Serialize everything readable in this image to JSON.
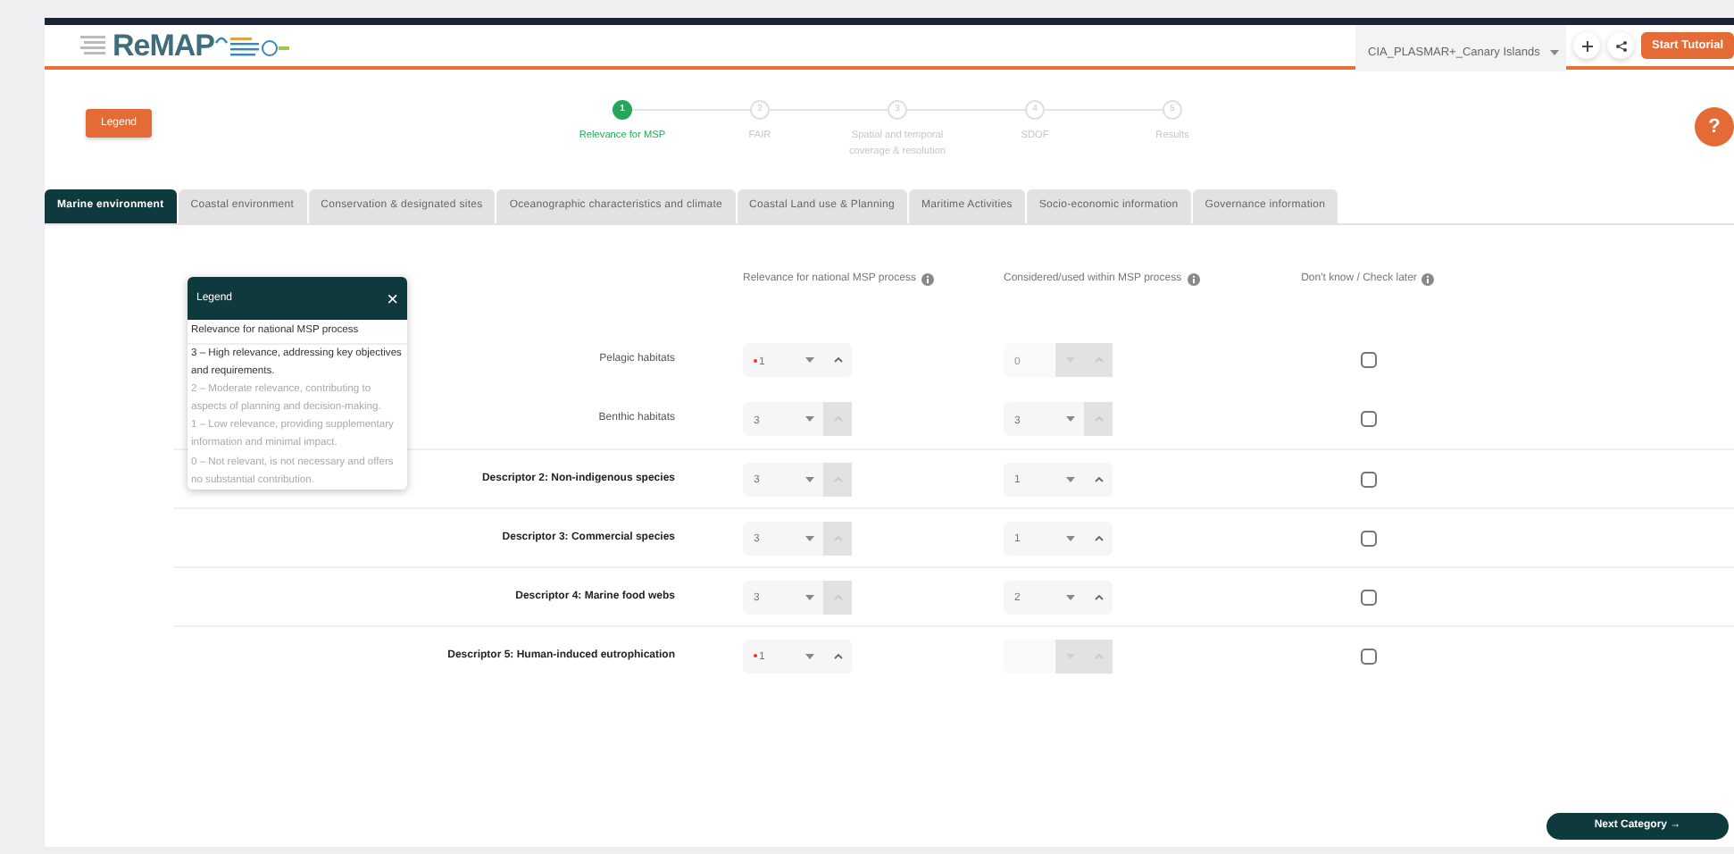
{
  "header": {
    "logo": "ReMAP",
    "country_select": {
      "value": "CIA_PLASMAR+_Canary Islands"
    },
    "start_tutorial": "Start Tutorial"
  },
  "legend_button": "Legend",
  "steps": [
    {
      "number": "1",
      "label": "Relevance for MSP",
      "selected": true
    },
    {
      "number": "2",
      "label": "FAIR",
      "selected": false
    },
    {
      "number": "3",
      "label": "Spatial and temporal coverage & resolution",
      "selected": false
    },
    {
      "number": "4",
      "label": "SDOF",
      "selected": false
    },
    {
      "number": "5",
      "label": "Results",
      "selected": false
    }
  ],
  "help_button": "?",
  "tabs": [
    {
      "label": "Marine environment",
      "selected": true
    },
    {
      "label": "Coastal environment",
      "selected": false
    },
    {
      "label": "Conservation & designated sites",
      "selected": false
    },
    {
      "label": "Oceanographic characteristics and climate",
      "selected": false
    },
    {
      "label": "Coastal Land use & Planning",
      "selected": false
    },
    {
      "label": "Maritime Activities",
      "selected": false
    },
    {
      "label": "Socio-economic information",
      "selected": false
    },
    {
      "label": "Governance information",
      "selected": false
    }
  ],
  "columns": [
    "Relevance for national MSP process",
    "Considered/used within MSP process",
    "Don't know / Check later"
  ],
  "rows": [
    {
      "label": "Pelagic habitats",
      "kind": "sub",
      "relevance": {
        "value": "1",
        "required": true,
        "disabled": false,
        "up_disabled": false
      },
      "considered": {
        "value": "0",
        "disabled": true,
        "up_disabled": true
      },
      "dont_know": false
    },
    {
      "label": "Benthic habitats",
      "kind": "sub",
      "relevance": {
        "value": "3",
        "required": false,
        "disabled": false,
        "up_disabled": true
      },
      "considered": {
        "value": "3",
        "disabled": false,
        "up_disabled": true
      },
      "dont_know": false
    },
    {
      "label": "Descriptor 2: Non-indigenous species",
      "kind": "descriptor",
      "relevance": {
        "value": "3",
        "required": false,
        "disabled": false,
        "up_disabled": true
      },
      "considered": {
        "value": "1",
        "disabled": false,
        "up_disabled": false
      },
      "dont_know": false
    },
    {
      "label": "Descriptor 3: Commercial species",
      "kind": "descriptor",
      "relevance": {
        "value": "3",
        "required": false,
        "disabled": false,
        "up_disabled": true
      },
      "considered": {
        "value": "1",
        "disabled": false,
        "up_disabled": false
      },
      "dont_know": false
    },
    {
      "label": "Descriptor 4: Marine food webs",
      "kind": "descriptor",
      "relevance": {
        "value": "3",
        "required": false,
        "disabled": false,
        "up_disabled": true
      },
      "considered": {
        "value": "2",
        "disabled": false,
        "up_disabled": false
      },
      "dont_know": false
    },
    {
      "label": "Descriptor 5: Human-induced eutrophication",
      "kind": "descriptor",
      "relevance": {
        "value": "1",
        "required": true,
        "disabled": false,
        "up_disabled": false
      },
      "considered": {
        "disabled": true,
        "up_disabled": true
      },
      "dont_know": false
    }
  ],
  "legend_popover": {
    "title": "Legend",
    "close": "×",
    "heading": "Relevance for national MSP process",
    "items": [
      {
        "text": "3 – High relevance, addressing key objectives and requirements.",
        "selected": true
      },
      {
        "text": "2 – Moderate relevance, contributing to aspects of planning and decision-making.",
        "selected": false
      },
      {
        "text": "1 – Low relevance, providing supplementary information and minimal impact.",
        "selected": false
      },
      {
        "text": "0 – Not relevant, is not necessary and offers no substantial contribution.",
        "selected": false
      }
    ]
  },
  "next_button": "Next Category →"
}
